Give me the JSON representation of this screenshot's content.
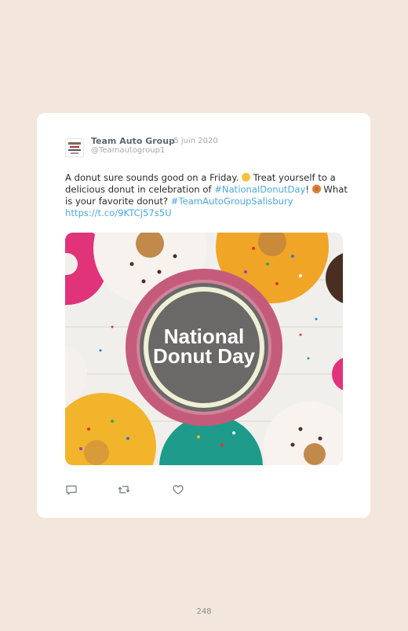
{
  "tweet": {
    "author_name": "Team Auto Group",
    "date": "· 5 juin 2020",
    "handle": "@Teamautogroup1",
    "text_part1": "A donut sure sounds good on a Friday. ",
    "text_part2": " Treat yourself to a delicious donut in celebration of ",
    "hashtag1": "#NationalDonutDay",
    "text_part3": "! ",
    "text_part4": " What is your favorite donut? ",
    "hashtag2": "#TeamAutoGroupSalisbury",
    "link": "https://t.co/9KTCj57s5U",
    "emoji1": "yum-face-emoji",
    "emoji2": "donut-emoji"
  },
  "image": {
    "line1": "National",
    "line2": "Donut Day"
  },
  "actions": {
    "reply_icon": "reply-icon",
    "retweet_icon": "retweet-icon",
    "like_icon": "heart-icon"
  },
  "footer": {
    "page_number": "248"
  },
  "colors": {
    "background": "#f3e7dd",
    "card": "#ffffff",
    "link": "#4aa8e6",
    "name": "#5c6670"
  }
}
